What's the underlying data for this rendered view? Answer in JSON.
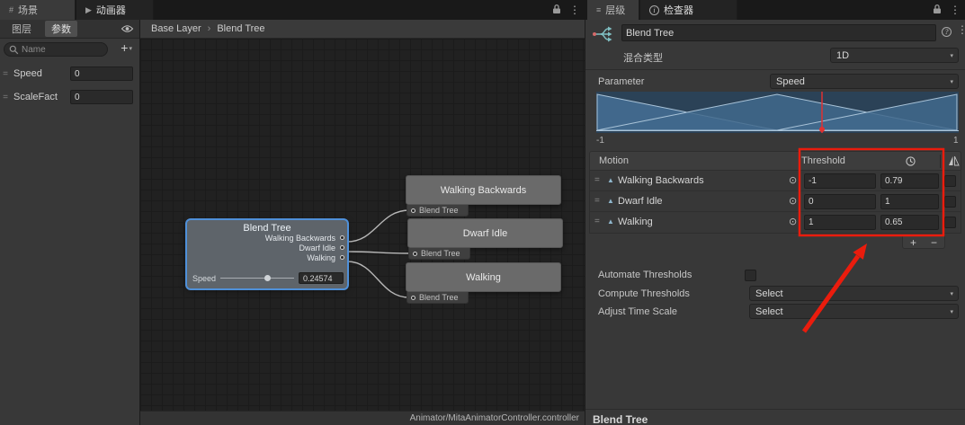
{
  "topbar": {
    "scene_tab": "场景",
    "animator_tab": "动画器",
    "hierarchy_tab": "层级",
    "inspector_tab": "检查器"
  },
  "left_panel": {
    "layers_tab": "图层",
    "parameters_tab": "参数",
    "search_placeholder": "Name",
    "add_button": "+",
    "parameters": [
      {
        "name": "Speed",
        "value": "0"
      },
      {
        "name": "ScaleFact",
        "value": "0"
      }
    ]
  },
  "graph": {
    "breadcrumb": {
      "root": "Base Layer",
      "current": "Blend Tree"
    },
    "status_bar": "Animator/MitaAnimatorController.controller",
    "blend_node": {
      "title": "Blend Tree",
      "outputs": [
        "Walking Backwards",
        "Dwarf Idle",
        "Walking"
      ],
      "param_label": "Speed",
      "param_value": "0.24574"
    },
    "motion_nodes": [
      {
        "title": "Walking Backwards",
        "subtitle": "Blend Tree"
      },
      {
        "title": "Dwarf Idle",
        "subtitle": "Blend Tree"
      },
      {
        "title": "Walking",
        "subtitle": "Blend Tree"
      }
    ]
  },
  "inspector": {
    "name_value": "Blend Tree",
    "blend_type_label": "混合类型",
    "blend_type_value": "1D",
    "parameter_label": "Parameter",
    "parameter_value": "Speed",
    "range_min": "-1",
    "range_max": "1",
    "table": {
      "motion_header": "Motion",
      "threshold_header": "Threshold",
      "rows": [
        {
          "motion": "Walking Backwards",
          "threshold": "-1",
          "speed": "0.79"
        },
        {
          "motion": "Dwarf Idle",
          "threshold": "0",
          "speed": "1"
        },
        {
          "motion": "Walking",
          "threshold": "1",
          "speed": "0.65"
        }
      ],
      "add_button": "+",
      "remove_button": "−"
    },
    "automate_thresholds_label": "Automate Thresholds",
    "compute_thresholds_label": "Compute Thresholds",
    "compute_thresholds_value": "Select",
    "adjust_time_scale_label": "Adjust Time Scale",
    "adjust_time_scale_value": "Select",
    "footer_title": "Blend Tree"
  }
}
